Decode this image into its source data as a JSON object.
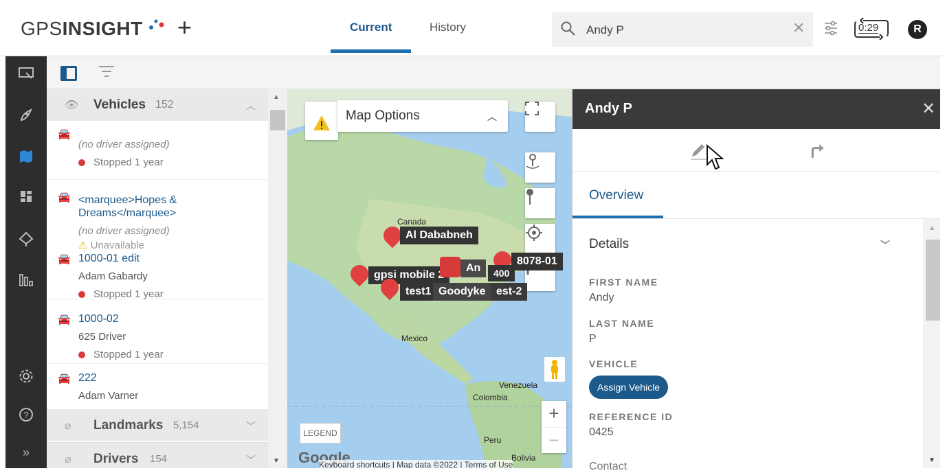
{
  "header": {
    "logo_text_light": "GPS",
    "logo_text_bold": "INSIGHT",
    "add_icon": "plus-icon",
    "tabs": [
      {
        "label": "Current",
        "active": true
      },
      {
        "label": "History",
        "active": false
      }
    ],
    "search": {
      "value": "Andy P",
      "icon": "search-icon",
      "clear_icon": "close-icon"
    },
    "settings_icon": "sliders-icon",
    "timer": "0:29",
    "avatar_initial": "R",
    "accent_color": "#1c5a8c"
  },
  "sidebar_nav": {
    "icons": [
      "monitor-icon",
      "rocket-icon",
      "map-icon",
      "dashboard-icon",
      "landmark-icon",
      "reports-icon",
      "settings-icon",
      "help-icon",
      "expand-icon"
    ],
    "expand_label": "»"
  },
  "list": {
    "vehicles": {
      "title": "Vehicles",
      "count": "152"
    },
    "items": [
      {
        "name": "",
        "driver": "(no driver assigned)",
        "status": "Stopped 1 year"
      },
      {
        "name": "<marquee>Hopes & Dreams</marquee>",
        "driver": "(no driver assigned)",
        "status": "Unavailable"
      },
      {
        "name": "1000-01 edit",
        "driver": "Adam Gabardy",
        "status": "Stopped 1 year"
      },
      {
        "name": "1000-02",
        "driver": "625 Driver",
        "status": "Stopped 1 year"
      },
      {
        "name": "222",
        "driver": "Adam Varner",
        "status": ""
      }
    ],
    "landmarks": {
      "title": "Landmarks",
      "count": "5,154"
    },
    "drivers": {
      "title": "Drivers",
      "count": "154"
    }
  },
  "map": {
    "options_label": "Map Options",
    "legend": "LEGEND",
    "google": "Google",
    "attribution": [
      "Keyboard shortcuts",
      "Map data ©2022",
      "Terms of Use"
    ],
    "places": [
      "Canada",
      "Mexico",
      "Venezuela",
      "Colombia",
      "Peru",
      "Bolivia"
    ],
    "markers": [
      {
        "label": "Al Dababneh"
      },
      {
        "label": "gpsi mobile 2"
      },
      {
        "label": "test1"
      },
      {
        "label": "Goodyke"
      },
      {
        "label": "est-2"
      },
      {
        "label": "An"
      },
      {
        "label": "8078-01"
      },
      {
        "label": "400"
      }
    ],
    "zoom_in": "+",
    "zoom_out": "−"
  },
  "detail": {
    "title": "Andy P",
    "tab": "Overview",
    "section": "Details",
    "fields": [
      {
        "label": "FIRST NAME",
        "value": "Andy"
      },
      {
        "label": "LAST NAME",
        "value": "P"
      },
      {
        "label": "VEHICLE",
        "value": ""
      },
      {
        "label": "REFERENCE ID",
        "value": "0425"
      }
    ],
    "assign_button": "Assign Vehicle",
    "next_label": "Contact"
  }
}
